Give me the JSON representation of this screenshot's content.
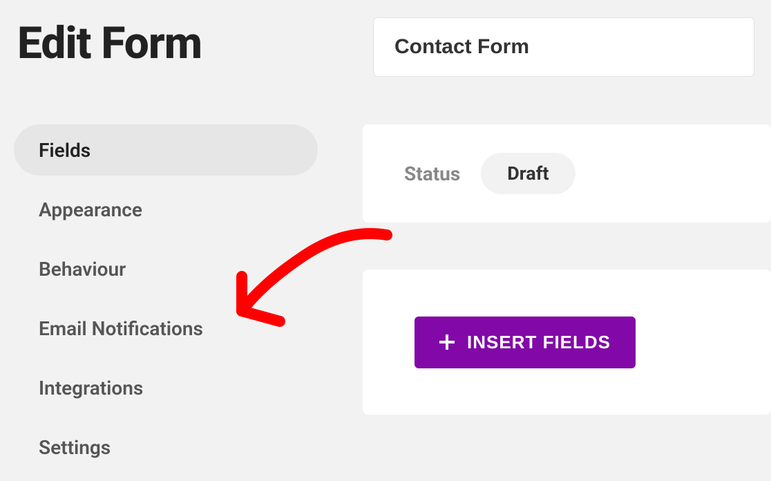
{
  "page": {
    "title": "Edit Form"
  },
  "form": {
    "name": "Contact Form"
  },
  "sidebar": {
    "items": [
      {
        "label": "Fields",
        "active": true
      },
      {
        "label": "Appearance",
        "active": false
      },
      {
        "label": "Behaviour",
        "active": false
      },
      {
        "label": "Email Notifications",
        "active": false
      },
      {
        "label": "Integrations",
        "active": false
      },
      {
        "label": "Settings",
        "active": false
      }
    ]
  },
  "status": {
    "label": "Status",
    "value": "Draft"
  },
  "actions": {
    "insert_fields": "INSERT FIELDS"
  }
}
